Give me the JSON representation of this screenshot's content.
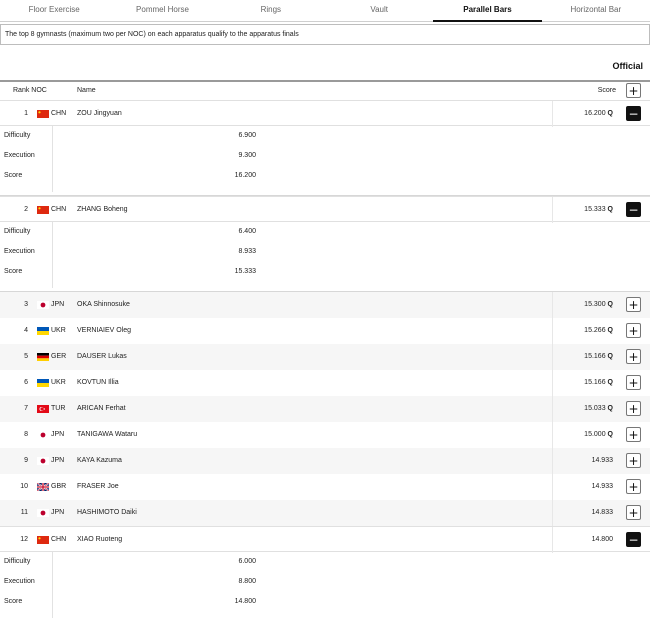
{
  "tabs": [
    {
      "label": "Floor Exercise",
      "active": false
    },
    {
      "label": "Pommel Horse",
      "active": false
    },
    {
      "label": "Rings",
      "active": false
    },
    {
      "label": "Vault",
      "active": false
    },
    {
      "label": "Parallel Bars",
      "active": true
    },
    {
      "label": "Horizontal Bar",
      "active": false
    }
  ],
  "notice": "The top 8 gymnasts (maximum two per NOC) on each apparatus qualify to the apparatus finals",
  "status_label": "Official",
  "columns": {
    "rank_noc": "Rank NOC",
    "name": "Name",
    "score": "Score"
  },
  "expand_all_symbol": "+",
  "detail_labels": {
    "difficulty": "Difficulty",
    "execution": "Execution",
    "score": "Score"
  },
  "results": [
    {
      "rank": "1",
      "noc": "CHN",
      "flag": "china",
      "name": "ZOU Jingyuan",
      "score": "16.200",
      "q": "Q",
      "expanded": true,
      "detail": {
        "difficulty": "6.900",
        "execution": "9.300",
        "score": "16.200"
      }
    },
    {
      "rank": "2",
      "noc": "CHN",
      "flag": "china",
      "name": "ZHANG Boheng",
      "score": "15.333",
      "q": "Q",
      "expanded": true,
      "detail": {
        "difficulty": "6.400",
        "execution": "8.933",
        "score": "15.333"
      }
    },
    {
      "rank": "3",
      "noc": "JPN",
      "flag": "japan",
      "name": "OKA Shinnosuke",
      "score": "15.300",
      "q": "Q",
      "expanded": false
    },
    {
      "rank": "4",
      "noc": "UKR",
      "flag": "ukraine",
      "name": "VERNIAIEV Oleg",
      "score": "15.266",
      "q": "Q",
      "expanded": false
    },
    {
      "rank": "5",
      "noc": "GER",
      "flag": "germany",
      "name": "DAUSER Lukas",
      "score": "15.166",
      "q": "Q",
      "expanded": false
    },
    {
      "rank": "6",
      "noc": "UKR",
      "flag": "ukraine",
      "name": "KOVTUN Illia",
      "score": "15.166",
      "q": "Q",
      "expanded": false
    },
    {
      "rank": "7",
      "noc": "TUR",
      "flag": "turkey",
      "name": "ARICAN Ferhat",
      "score": "15.033",
      "q": "Q",
      "expanded": false
    },
    {
      "rank": "8",
      "noc": "JPN",
      "flag": "japan",
      "name": "TANIGAWA Wataru",
      "score": "15.000",
      "q": "Q",
      "expanded": false
    },
    {
      "rank": "9",
      "noc": "JPN",
      "flag": "japan",
      "name": "KAYA Kazuma",
      "score": "14.933",
      "q": "",
      "expanded": false
    },
    {
      "rank": "10",
      "noc": "GBR",
      "flag": "uk",
      "name": "FRASER Joe",
      "score": "14.933",
      "q": "",
      "expanded": false
    },
    {
      "rank": "11",
      "noc": "JPN",
      "flag": "japan",
      "name": "HASHIMOTO Daiki",
      "score": "14.833",
      "q": "",
      "expanded": false
    },
    {
      "rank": "12",
      "noc": "CHN",
      "flag": "china",
      "name": "XIAO Ruoteng",
      "score": "14.800",
      "q": "",
      "expanded": true,
      "detail": {
        "difficulty": "6.000",
        "execution": "8.800",
        "score": "14.800"
      }
    }
  ],
  "colors": {
    "accent": "#111111",
    "china": "#de2910",
    "japan_dot": "#bc002d",
    "ukraine_blue": "#0057b7",
    "ukraine_yellow": "#ffd700",
    "turkey": "#e30a17"
  }
}
